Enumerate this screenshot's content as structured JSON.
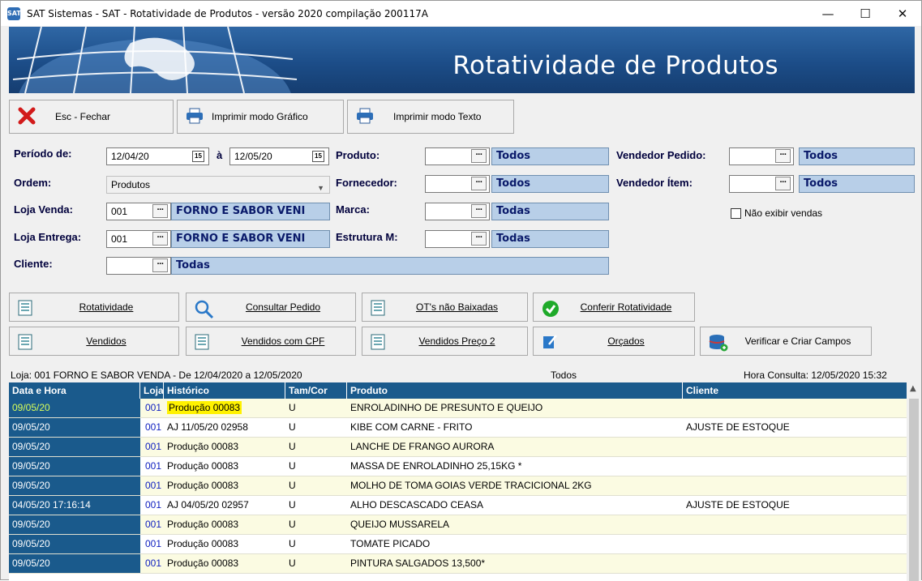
{
  "window": {
    "title": "SAT Sistemas - SAT - Rotatividade de Produtos - versão 2020 compilação 200117A",
    "minimize": "—",
    "maximize": "☐",
    "close": "✕"
  },
  "banner": {
    "title": "Rotatividade de Produtos"
  },
  "toolbar": {
    "close_label": "Esc - Fechar",
    "print_graphic_label": "Imprimir modo Gráfico",
    "print_text_label": "Imprimir modo Texto"
  },
  "filters": {
    "periodo_label": "Período de:",
    "periodo_from": "12/04/20",
    "periodo_sep": "à",
    "periodo_to": "12/05/20",
    "calendar_glyph": "15",
    "ordem_label": "Ordem:",
    "ordem_value": "Produtos",
    "loja_venda_label": "Loja Venda:",
    "loja_venda_code": "001",
    "loja_venda_name": "FORNO E SABOR VENI",
    "loja_entrega_label": "Loja Entrega:",
    "loja_entrega_code": "001",
    "loja_entrega_name": "FORNO E SABOR VENI",
    "cliente_label": "Cliente:",
    "cliente_value": "Todas",
    "produto_label": "Produto:",
    "produto_value": "Todos",
    "fornecedor_label": "Fornecedor:",
    "fornecedor_value": "Todos",
    "marca_label": "Marca:",
    "marca_value": "Todas",
    "estrutura_label": "Estrutura M:",
    "estrutura_value": "Todas",
    "vendedor_pedido_label": "Vendedor Pedido:",
    "vendedor_pedido_value": "Todos",
    "vendedor_item_label": "Vendedor Ítem:",
    "vendedor_item_value": "Todos",
    "nao_exibir_label": "Não exibir vendas",
    "ellipsis": "···"
  },
  "actions": {
    "rotatividade": "Rotatividade",
    "consultar_pedido": "Consultar Pedido",
    "ots_nao_baixadas": "OT's não Baixadas",
    "conferir_rotatividade": "Conferir Rotatividade",
    "vendidos": "Vendidos",
    "vendidos_cpf": "Vendidos com CPF",
    "vendidos_preco2": "Vendidos Preço 2",
    "orcados": "Orçados",
    "verificar_campos": "Verificar e Criar Campos"
  },
  "grid_info": {
    "left": "Loja: 001 FORNO E SABOR VENDA - De 12/04/2020 a 12/05/2020",
    "center": "Todos",
    "right": "Hora Consulta: 12/05/2020 15:32"
  },
  "grid": {
    "headers": [
      "Data e Hora",
      "Loja",
      "Histórico",
      "Tam/Cor",
      "Produto",
      "Cliente"
    ],
    "rows": [
      {
        "data": "09/05/20",
        "loja": "001",
        "historico": "Produção 00083",
        "tam": "U",
        "produto": "ENROLADINHO DE PRESUNTO E QUEIJO",
        "cliente": ""
      },
      {
        "data": "09/05/20",
        "loja": "001",
        "historico": "AJ 11/05/20 02958",
        "tam": "U",
        "produto": "KIBE COM CARNE - FRITO",
        "cliente": "AJUSTE DE ESTOQUE"
      },
      {
        "data": "09/05/20",
        "loja": "001",
        "historico": "Produção 00083",
        "tam": "U",
        "produto": "LANCHE DE FRANGO AURORA",
        "cliente": ""
      },
      {
        "data": "09/05/20",
        "loja": "001",
        "historico": "Produção 00083",
        "tam": "U",
        "produto": "MASSA DE ENROLADINHO 25,15KG *",
        "cliente": ""
      },
      {
        "data": "09/05/20",
        "loja": "001",
        "historico": "Produção 00083",
        "tam": "U",
        "produto": "MOLHO DE TOMA GOIAS VERDE TRACICIONAL 2KG",
        "cliente": ""
      },
      {
        "data": "04/05/20 17:16:14",
        "loja": "001",
        "historico": "AJ 04/05/20 02957",
        "tam": "U",
        "produto": "ALHO DESCASCADO CEASA",
        "cliente": "AJUSTE DE ESTOQUE"
      },
      {
        "data": "09/05/20",
        "loja": "001",
        "historico": "Produção 00083",
        "tam": "U",
        "produto": "QUEIJO MUSSARELA",
        "cliente": ""
      },
      {
        "data": "09/05/20",
        "loja": "001",
        "historico": "Produção 00083",
        "tam": "U",
        "produto": "TOMATE PICADO",
        "cliente": ""
      },
      {
        "data": "09/05/20",
        "loja": "001",
        "historico": "Produção 00083",
        "tam": "U",
        "produto": "PINTURA SALGADOS 13,500*",
        "cliente": ""
      }
    ]
  },
  "colors": {
    "banner": "#1c4d88",
    "grid_header": "#1a5a8c",
    "info_field": "#b8cfe8",
    "row_odd": "#fbfbe2",
    "highlight": "#fff200"
  }
}
